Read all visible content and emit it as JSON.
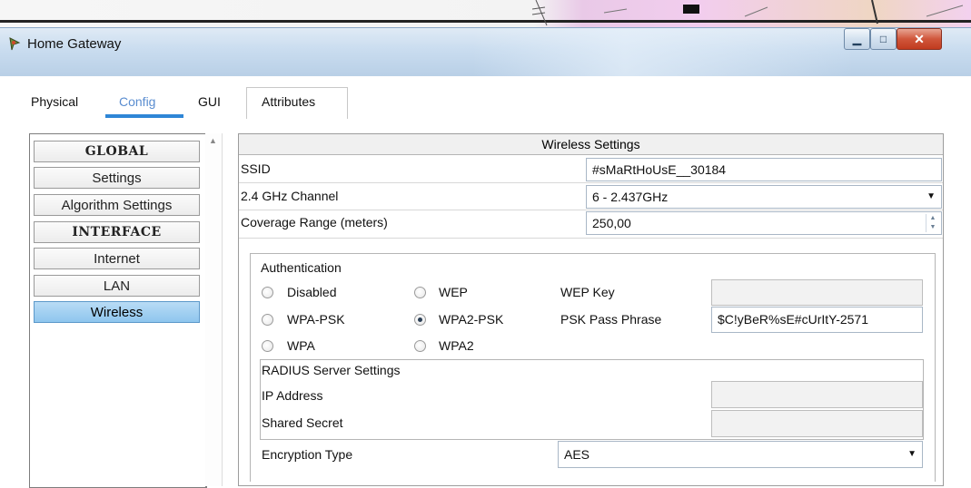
{
  "window": {
    "title": "Home Gateway",
    "controls": [
      "minimize",
      "maximize",
      "close"
    ]
  },
  "tabs": [
    {
      "label": "Physical",
      "active": false
    },
    {
      "label": "Config",
      "active": true
    },
    {
      "label": "GUI",
      "active": false
    },
    {
      "label": "Attributes",
      "active": false
    }
  ],
  "sidebar": {
    "items": [
      {
        "label": "GLOBAL",
        "type": "header"
      },
      {
        "label": "Settings",
        "type": "item"
      },
      {
        "label": "Algorithm Settings",
        "type": "item"
      },
      {
        "label": "INTERFACE",
        "type": "header"
      },
      {
        "label": "Internet",
        "type": "item"
      },
      {
        "label": "LAN",
        "type": "item"
      },
      {
        "label": "Wireless",
        "type": "item",
        "selected": true
      }
    ]
  },
  "wireless": {
    "section_title": "Wireless Settings",
    "ssid_label": "SSID",
    "ssid_value": "#sMaRtHoUsE__30184",
    "channel_label": "2.4 GHz Channel",
    "channel_value": "6 - 2.437GHz",
    "coverage_label": "Coverage Range (meters)",
    "coverage_value": "250,00"
  },
  "auth": {
    "label": "Authentication",
    "options": {
      "disabled": "Disabled",
      "wep": "WEP",
      "wpa_psk": "WPA-PSK",
      "wpa2_psk": "WPA2-PSK",
      "wpa": "WPA",
      "wpa2": "WPA2"
    },
    "selected": "WPA2-PSK",
    "wep_key_label": "WEP Key",
    "wep_key_value": "",
    "psk_label": "PSK Pass Phrase",
    "psk_value": "$C!yBeR%sE#cUrItY-2571",
    "radius": {
      "title": "RADIUS Server Settings",
      "ip_label": "IP Address",
      "ip_value": "",
      "secret_label": "Shared Secret",
      "secret_value": ""
    },
    "encryption_label": "Encryption Type",
    "encryption_value": "AES"
  },
  "colors": {
    "tab_active": "#5a8dd0",
    "tab_underline": "#2e86d6",
    "selected_nav": "#8ec6ee",
    "close_button": "#c13b1f"
  }
}
